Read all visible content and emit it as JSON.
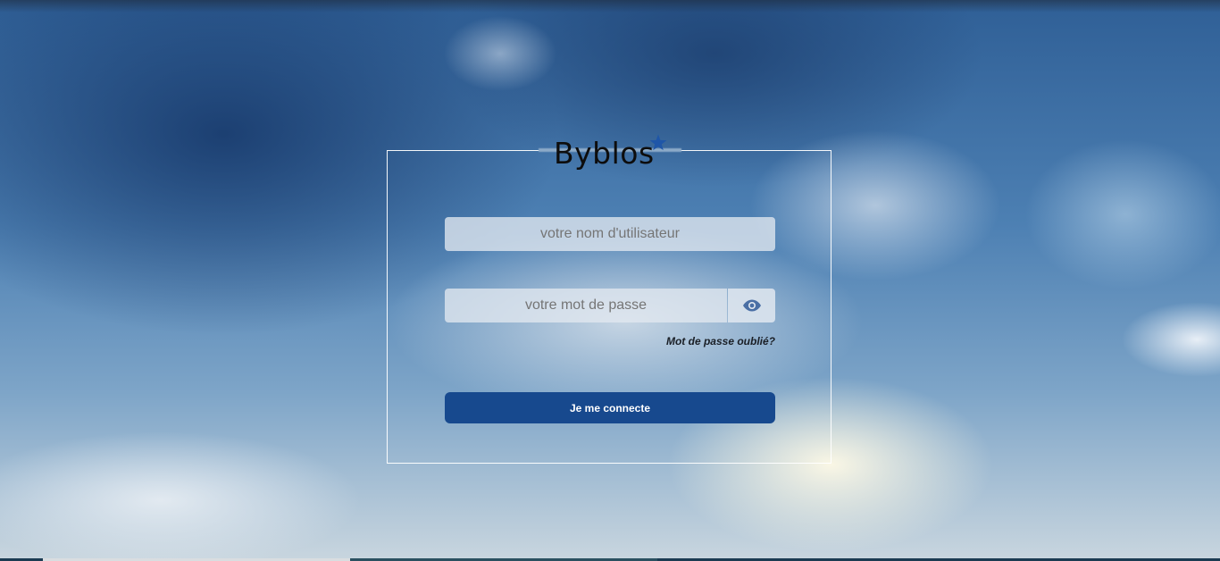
{
  "brand": {
    "name": "Byblos",
    "star_color": "#1f56a8"
  },
  "login": {
    "username_placeholder": "votre nom d'utilisateur",
    "password_placeholder": "votre mot de passe",
    "show_password_icon": "eye-icon",
    "forgot_password": "Mot de passe oublié?",
    "submit_label": "Je me connecte"
  },
  "colors": {
    "button": "#17498e",
    "eye_icon": "#4a6fa5"
  }
}
